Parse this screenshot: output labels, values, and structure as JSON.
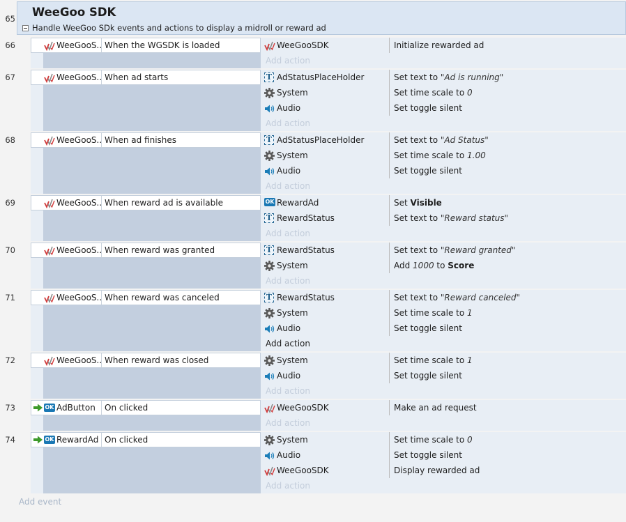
{
  "group": {
    "line": "65",
    "title": "WeeGoo SDK",
    "description": "Handle WeeGoo SDk events and actions to display a midroll or reward ad"
  },
  "events": [
    {
      "line": "66",
      "condition": {
        "icon": "weegoo-icon",
        "object": "WeeGooS...",
        "text": "When the WGSDK is loaded"
      },
      "actions": [
        {
          "icon": "weegoo-icon",
          "object": "WeeGooSDK",
          "parts": [
            {
              "t": "Initialize rewarded ad"
            }
          ]
        }
      ],
      "add_action": "Add action"
    },
    {
      "line": "67",
      "condition": {
        "icon": "weegoo-icon",
        "object": "WeeGooS...",
        "text": "When ad starts"
      },
      "actions": [
        {
          "icon": "text-icon",
          "object": "AdStatusPlaceHolder",
          "parts": [
            {
              "t": "Set text to "
            },
            {
              "t": "\"Ad is running\"",
              "s": "i"
            }
          ]
        },
        {
          "icon": "gear-icon",
          "object": "System",
          "parts": [
            {
              "t": "Set time scale to "
            },
            {
              "t": "0",
              "s": "i"
            }
          ]
        },
        {
          "icon": "audio-icon",
          "object": "Audio",
          "parts": [
            {
              "t": "Set toggle silent"
            }
          ]
        }
      ],
      "add_action": "Add action"
    },
    {
      "line": "68",
      "condition": {
        "icon": "weegoo-icon",
        "object": "WeeGooS...",
        "text": "When ad finishes"
      },
      "actions": [
        {
          "icon": "text-icon",
          "object": "AdStatusPlaceHolder",
          "parts": [
            {
              "t": "Set text to "
            },
            {
              "t": "\"Ad Status\"",
              "s": "i"
            }
          ]
        },
        {
          "icon": "gear-icon",
          "object": "System",
          "parts": [
            {
              "t": "Set time scale to "
            },
            {
              "t": "1.00",
              "s": "i"
            }
          ]
        },
        {
          "icon": "audio-icon",
          "object": "Audio",
          "parts": [
            {
              "t": "Set toggle silent"
            }
          ]
        }
      ],
      "add_action": "Add action"
    },
    {
      "line": "69",
      "condition": {
        "icon": "weegoo-icon",
        "object": "WeeGooS...",
        "text": "When reward ad is available"
      },
      "actions": [
        {
          "icon": "button-icon",
          "object": "RewardAd",
          "parts": [
            {
              "t": "Set "
            },
            {
              "t": "Visible",
              "s": "b"
            }
          ]
        },
        {
          "icon": "text-icon",
          "object": "RewardStatus",
          "parts": [
            {
              "t": "Set text to "
            },
            {
              "t": "\"Reward status\"",
              "s": "i"
            }
          ]
        }
      ],
      "add_action": "Add action"
    },
    {
      "line": "70",
      "condition": {
        "icon": "weegoo-icon",
        "object": "WeeGooS...",
        "text": "When reward was granted"
      },
      "actions": [
        {
          "icon": "text-icon",
          "object": "RewardStatus",
          "parts": [
            {
              "t": "Set text to "
            },
            {
              "t": "\"Reward granted\"",
              "s": "i"
            }
          ]
        },
        {
          "icon": "gear-icon",
          "object": "System",
          "parts": [
            {
              "t": "Add "
            },
            {
              "t": "1000",
              "s": "i"
            },
            {
              "t": " to "
            },
            {
              "t": "Score",
              "s": "b"
            }
          ]
        }
      ],
      "add_action": "Add action"
    },
    {
      "line": "71",
      "condition": {
        "icon": "weegoo-icon",
        "object": "WeeGooS...",
        "text": "When reward was canceled"
      },
      "actions": [
        {
          "icon": "text-icon",
          "object": "RewardStatus",
          "parts": [
            {
              "t": "Set text to "
            },
            {
              "t": "\"Reward canceled\"",
              "s": "i"
            }
          ]
        },
        {
          "icon": "gear-icon",
          "object": "System",
          "parts": [
            {
              "t": "Set time scale to "
            },
            {
              "t": "1",
              "s": "i"
            }
          ]
        },
        {
          "icon": "audio-icon",
          "object": "Audio",
          "parts": [
            {
              "t": "Set toggle silent"
            }
          ]
        }
      ],
      "add_action": "Add action",
      "add_action_active": true
    },
    {
      "line": "72",
      "condition": {
        "icon": "weegoo-icon",
        "object": "WeeGooS...",
        "text": "When reward was closed"
      },
      "actions": [
        {
          "icon": "gear-icon",
          "object": "System",
          "parts": [
            {
              "t": "Set time scale to "
            },
            {
              "t": "1",
              "s": "i"
            }
          ]
        },
        {
          "icon": "audio-icon",
          "object": "Audio",
          "parts": [
            {
              "t": "Set toggle silent"
            }
          ]
        }
      ],
      "add_action": "Add action"
    },
    {
      "line": "73",
      "condition": {
        "icon": "button-icon",
        "trigger": true,
        "object": "AdButton",
        "text": "On clicked"
      },
      "actions": [
        {
          "icon": "weegoo-icon",
          "object": "WeeGooSDK",
          "parts": [
            {
              "t": "Make an ad request"
            }
          ]
        }
      ],
      "add_action": "Add action"
    },
    {
      "line": "74",
      "condition": {
        "icon": "button-icon",
        "trigger": true,
        "object": "RewardAd",
        "text": "On clicked"
      },
      "actions": [
        {
          "icon": "gear-icon",
          "object": "System",
          "parts": [
            {
              "t": "Set time scale to "
            },
            {
              "t": "0",
              "s": "i"
            }
          ]
        },
        {
          "icon": "audio-icon",
          "object": "Audio",
          "parts": [
            {
              "t": "Set toggle silent"
            }
          ]
        },
        {
          "icon": "weegoo-icon",
          "object": "WeeGooSDK",
          "parts": [
            {
              "t": "Display rewarded ad"
            }
          ]
        }
      ],
      "add_action": "Add action"
    }
  ],
  "add_event": "Add event",
  "colors": {
    "group_header": "#dbe6f3",
    "condition_strip": "#c3cfdf",
    "add_placeholder": "#c3cddb"
  }
}
